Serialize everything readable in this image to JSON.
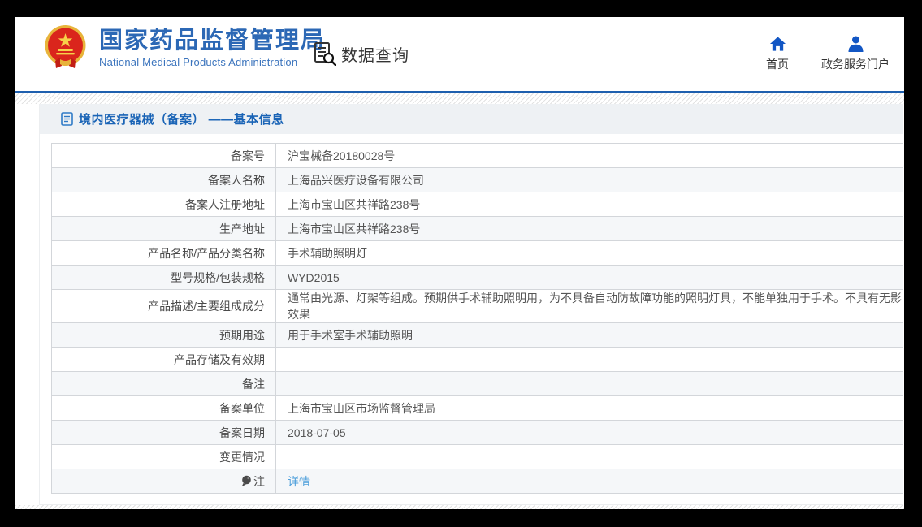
{
  "header": {
    "logo": {
      "title": "国家药品监督管理局",
      "subtitle": "National Medical Products Administration",
      "emblem_icon": "china-national-emblem-icon"
    },
    "section": {
      "label": "数据查询",
      "icon": "document-search-icon"
    },
    "nav": [
      {
        "label": "首页",
        "icon": "home-icon"
      },
      {
        "label": "政务服务门户",
        "icon": "person-icon"
      }
    ]
  },
  "page": {
    "title": "境内医疗器械（备案） ——基本信息",
    "title_icon": "document-icon"
  },
  "table": {
    "rows": [
      {
        "label": "备案号",
        "value": "沪宝械备20180028号"
      },
      {
        "label": "备案人名称",
        "value": "上海品兴医疗设备有限公司"
      },
      {
        "label": "备案人注册地址",
        "value": "上海市宝山区共祥路238号"
      },
      {
        "label": "生产地址",
        "value": "上海市宝山区共祥路238号"
      },
      {
        "label": "产品名称/产品分类名称",
        "value": "手术辅助照明灯"
      },
      {
        "label": "型号规格/包装规格",
        "value": "WYD2015"
      },
      {
        "label": "产品描述/主要组成成分",
        "value": "通常由光源、灯架等组成。预期供手术辅助照明用，为不具备自动防故障功能的照明灯具，不能单独用于手术。不具有无影效果"
      },
      {
        "label": "预期用途",
        "value": "用于手术室手术辅助照明"
      },
      {
        "label": "产品存储及有效期",
        "value": ""
      },
      {
        "label": "备注",
        "value": ""
      },
      {
        "label": "备案单位",
        "value": "上海市宝山区市场监督管理局"
      },
      {
        "label": "备案日期",
        "value": "2018-07-05"
      },
      {
        "label": "变更情况",
        "value": ""
      },
      {
        "label": "注",
        "label_icon": "note-balloon-icon",
        "link_label": "详情"
      }
    ]
  },
  "colors": {
    "brand_blue": "#2c68b5",
    "divider_blue": "#1e5fae",
    "nav_icon_blue": "#1256c4",
    "page_title_blue": "#1a64b6",
    "link_blue": "#4d9fdb",
    "zebra_row": "#f5f7f9",
    "frame_black": "#000000"
  }
}
